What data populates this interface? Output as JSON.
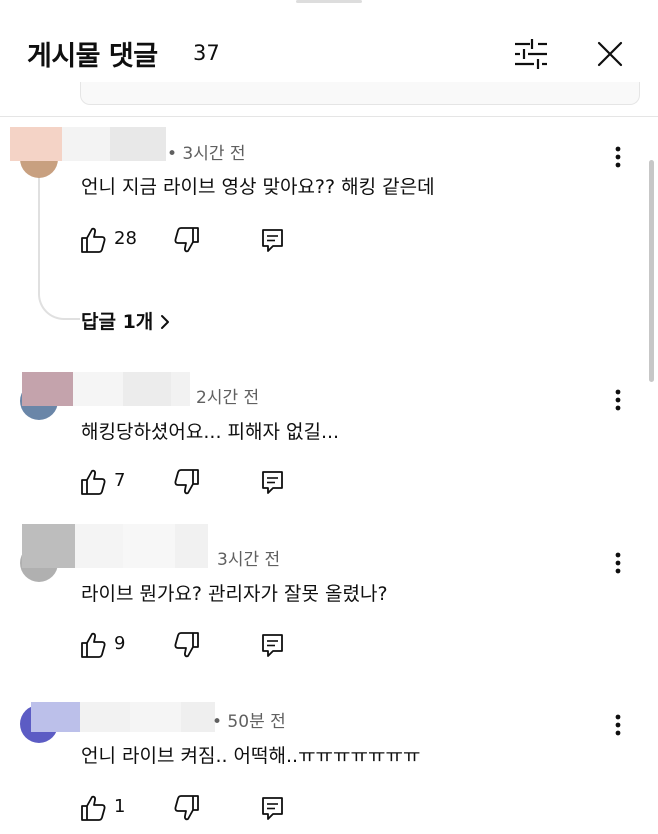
{
  "header": {
    "title": "게시물 댓글",
    "count": "37"
  },
  "comments": [
    {
      "time": "• 3시간 전",
      "text": "언니 지금 라이브 영상 맞아요?? 해킹 같은데",
      "likes": "28",
      "replies_label": "답글 1개"
    },
    {
      "time": "2시간 전",
      "text": "해킹당하셨어요... 피해자 없길...",
      "likes": "7"
    },
    {
      "time": "3시간 전",
      "text": "라이브 뭔가요? 관리자가 잘못 올렸나?",
      "likes": "9"
    },
    {
      "time": "• 50분 전",
      "text": "언니 라이브 켜짐.. 어떡해..ㅠㅠㅠㅠㅠㅠㅠ",
      "likes": "1"
    }
  ],
  "icons": {
    "filter": "sliders-icon",
    "close": "close-icon",
    "like": "thumbs-up-icon",
    "dislike": "thumbs-down-icon",
    "reply": "comment-icon",
    "more": "more-vertical-icon",
    "chevron": "chevron-right-icon"
  },
  "colors": {
    "text": "#0f0f0f",
    "secondary_text": "#606060",
    "divider": "#e5e5e5",
    "blurred_name": "#ebebeb"
  }
}
